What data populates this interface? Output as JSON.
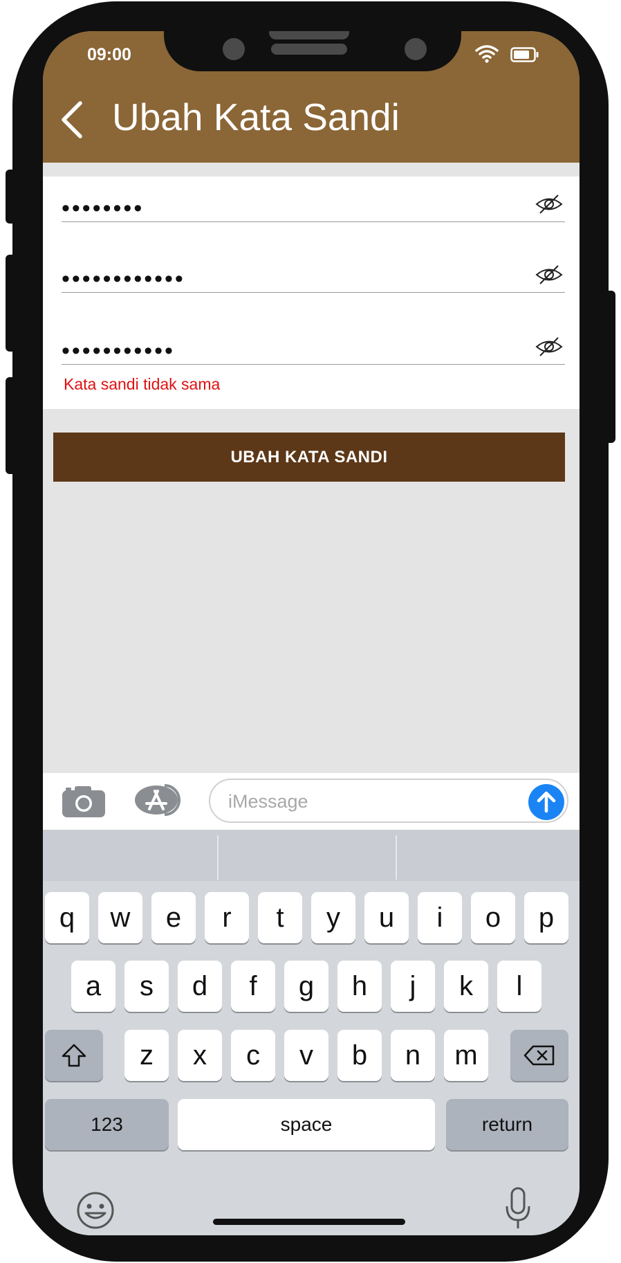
{
  "status_bar": {
    "time": "09:00"
  },
  "header": {
    "title": "Ubah Kata Sandi"
  },
  "form": {
    "fields": [
      {
        "masked_value": "••••••••"
      },
      {
        "masked_value": "••••••••••••"
      },
      {
        "masked_value": "•••••••••••"
      }
    ],
    "error": "Kata sandi tidak sama"
  },
  "submit_button": {
    "label": "UBAH KATA SANDI"
  },
  "message_bar": {
    "placeholder": "iMessage"
  },
  "keyboard": {
    "row1": [
      "q",
      "w",
      "e",
      "r",
      "t",
      "y",
      "u",
      "i",
      "o",
      "p"
    ],
    "row2": [
      "a",
      "s",
      "d",
      "f",
      "g",
      "h",
      "j",
      "k",
      "l"
    ],
    "row3": [
      "z",
      "x",
      "c",
      "v",
      "b",
      "n",
      "m"
    ],
    "numbers_label": "123",
    "space_label": "space",
    "return_label": "return"
  },
  "colors": {
    "header_bg": "#8b6636",
    "button_bg": "#5c3818",
    "error": "#e01010",
    "send": "#1a84f5"
  }
}
